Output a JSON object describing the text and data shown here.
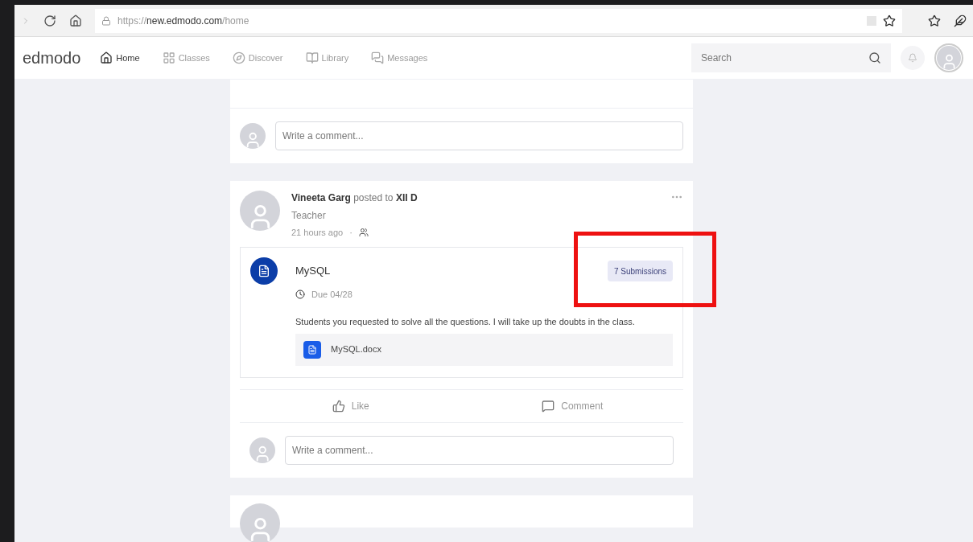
{
  "browser": {
    "url_host": "new.edmodo.com",
    "url_scheme": "https://",
    "url_path": "/home"
  },
  "nav": {
    "logo": "edmodo",
    "items": [
      {
        "label": "Home",
        "kind": "home",
        "selected": true
      },
      {
        "label": "Classes",
        "kind": "classes",
        "selected": false
      },
      {
        "label": "Discover",
        "kind": "discover",
        "selected": false
      },
      {
        "label": "Library",
        "kind": "library",
        "selected": false
      },
      {
        "label": "Messages",
        "kind": "messages",
        "selected": false
      }
    ],
    "search_placeholder": "Search"
  },
  "top_card": {
    "comment_placeholder": "Write a comment..."
  },
  "post": {
    "author": "Vineeta Garg",
    "verb": "posted to",
    "group": "XII D",
    "role": "Teacher",
    "time": "21 hours ago",
    "separator": "·",
    "assignment": {
      "title": "MySQL",
      "submissions": "7 Submissions",
      "due": "Due 04/28",
      "description": "Students you requested to solve all the questions. I will take up the doubts in the class.",
      "attachment": "MySQL.docx"
    },
    "actions": [
      "Like",
      "Comment"
    ],
    "comment_placeholder": "Write a comment..."
  },
  "highlight": {
    "on": true
  }
}
